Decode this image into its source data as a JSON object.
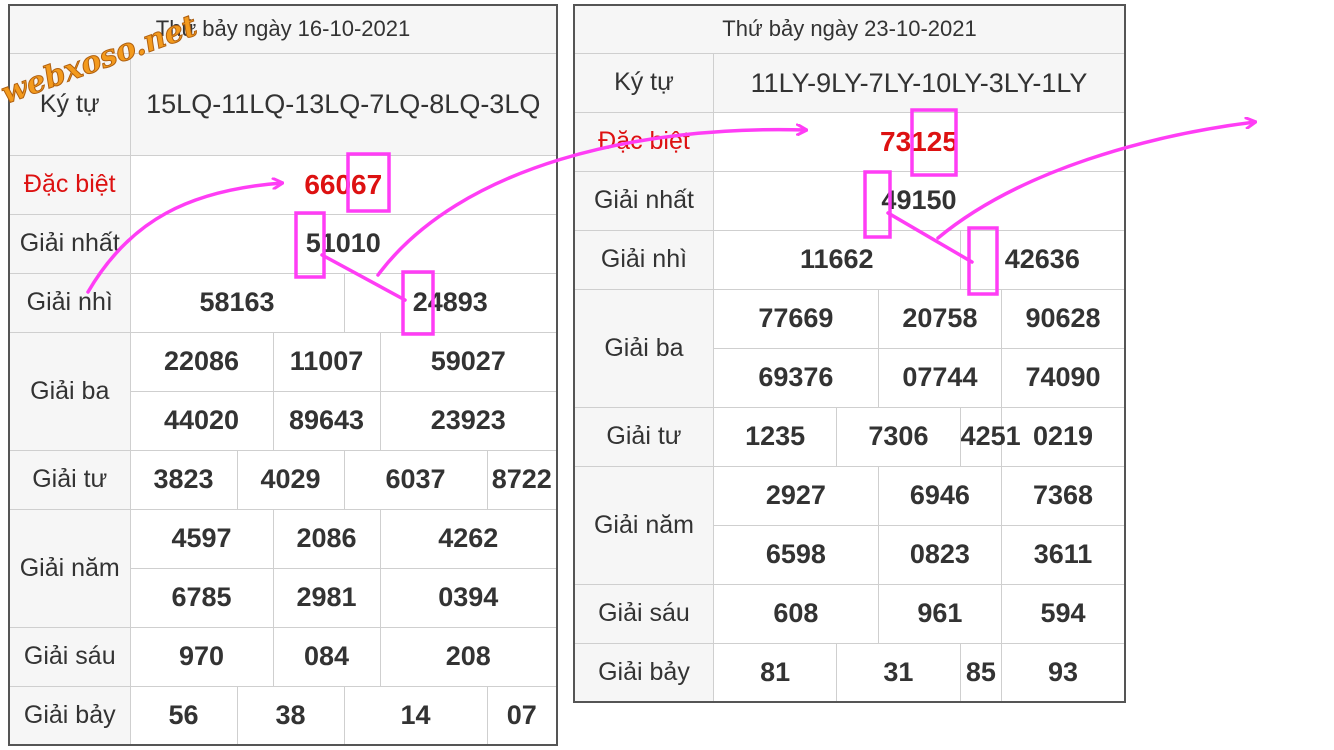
{
  "watermark": "webxoso.net",
  "highlight_color": "#ff3df5",
  "special_color": "#dd1111",
  "labels": {
    "ky_tu": "Ký tự",
    "dac_biet": "Đặc biệt",
    "giai_nhat": "Giải nhất",
    "giai_nhi": "Giải nhì",
    "giai_ba": "Giải ba",
    "giai_tu": "Giải tư",
    "giai_nam": "Giải năm",
    "giai_sau": "Giải sáu",
    "giai_bay": "Giải bảy"
  },
  "draws": [
    {
      "title": "Thứ bảy ngày 16-10-2021",
      "ky_tu": "15LQ-11LQ-13LQ-7LQ-8LQ-3LQ",
      "dac_biet": "66067",
      "giai_nhat": "51010",
      "giai_nhi": [
        "58163",
        "24893"
      ],
      "giai_ba": [
        "22086",
        "11007",
        "59027",
        "44020",
        "89643",
        "23923"
      ],
      "giai_tu": [
        "3823",
        "4029",
        "6037",
        "8722"
      ],
      "giai_nam": [
        "4597",
        "2086",
        "4262",
        "6785",
        "2981",
        "0394"
      ],
      "giai_sau": [
        "970",
        "084",
        "208"
      ],
      "giai_bay": [
        "56",
        "38",
        "14",
        "07"
      ]
    },
    {
      "title": "Thứ bảy ngày 23-10-2021",
      "ky_tu": "11LY-9LY-7LY-10LY-3LY-1LY",
      "dac_biet": "73125",
      "giai_nhat": "49150",
      "giai_nhi": [
        "11662",
        "42636"
      ],
      "giai_ba": [
        "77669",
        "20758",
        "90628",
        "69376",
        "07744",
        "74090"
      ],
      "giai_tu": [
        "1235",
        "7306",
        "4251",
        "0219"
      ],
      "giai_nam": [
        "2927",
        "6946",
        "7368",
        "6598",
        "0823",
        "3611"
      ],
      "giai_sau": [
        "608",
        "961",
        "594"
      ],
      "giai_bay": [
        "81",
        "31",
        "85",
        "93"
      ]
    }
  ]
}
